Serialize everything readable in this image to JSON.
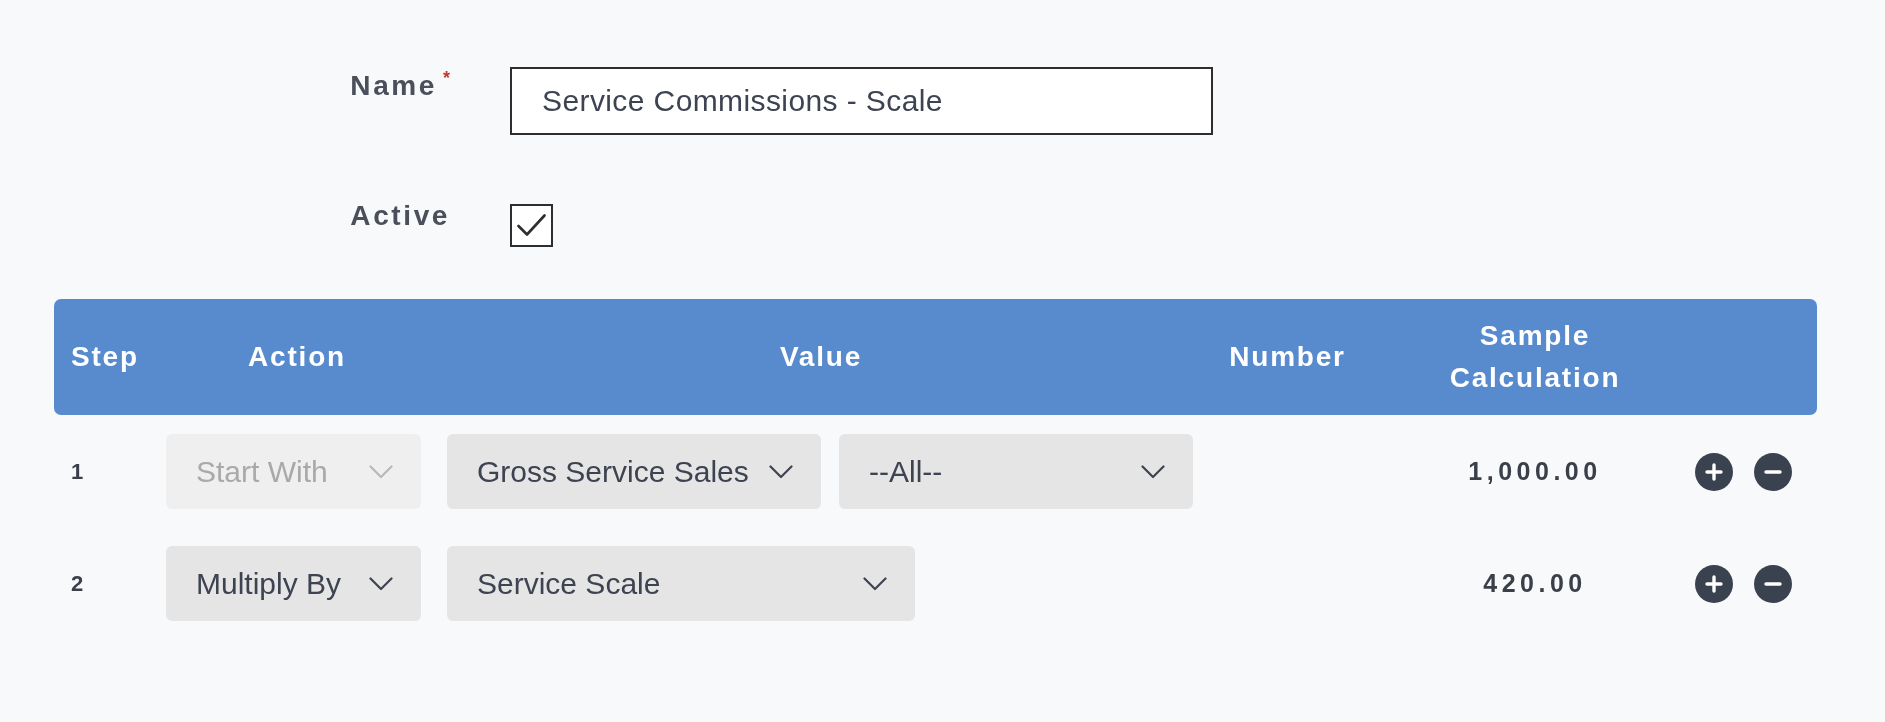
{
  "form": {
    "name_field": {
      "label": "Name",
      "required_mark": "*",
      "value": "Service Commissions - Scale"
    },
    "active_field": {
      "label": "Active",
      "checked": true
    }
  },
  "table": {
    "columns": [
      "Step",
      "Action",
      "Value",
      "Number",
      "Sample Calculation"
    ],
    "rows": [
      {
        "step": "1",
        "action": {
          "value": "Start With",
          "disabled": true
        },
        "value_selects": [
          {
            "value": "Gross Service Sales",
            "disabled": false
          },
          {
            "value": "--All--",
            "disabled": false
          }
        ],
        "sample_calculation": "1,000.00"
      },
      {
        "step": "2",
        "action": {
          "value": "Multiply By",
          "disabled": false
        },
        "value_selects": [
          {
            "value": "Service Scale",
            "disabled": false
          }
        ],
        "sample_calculation": "420.00"
      }
    ]
  }
}
